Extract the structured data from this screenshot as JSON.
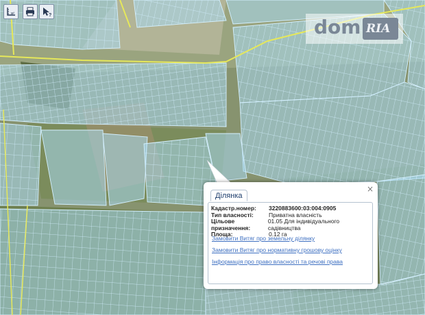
{
  "toolbar": {
    "measure_icon": "ruler-measure-icon",
    "measure_label": "м²",
    "print_icon": "printer-icon",
    "info_icon": "pointer-query-icon",
    "info_label": "?"
  },
  "watermark": {
    "dom": "dom",
    "ria": "RIA"
  },
  "popup": {
    "tab_label": "Ділянка",
    "close_label": "×",
    "fields": [
      {
        "label": "Кадастр.номер:",
        "value": "3220883600:03:004:0905",
        "bold": true
      },
      {
        "label": "Тип власності:",
        "value": "Приватна власність"
      },
      {
        "label": "Цільове призначення:",
        "value": "01.05 Для індивідуального садівництва"
      },
      {
        "label": "Площа:",
        "value": "0.12 га"
      }
    ],
    "links": [
      "Замовити Витяг про земельну ділянку",
      "Замовити Витяг про нормативну грошову оцінку",
      "Інформація про право власності та речові права"
    ]
  },
  "colors": {
    "parcel_fill": "#a8d8f0",
    "parcel_stroke": "#c8ecff",
    "road": "#e6e85a",
    "link": "#3d6fc1"
  }
}
